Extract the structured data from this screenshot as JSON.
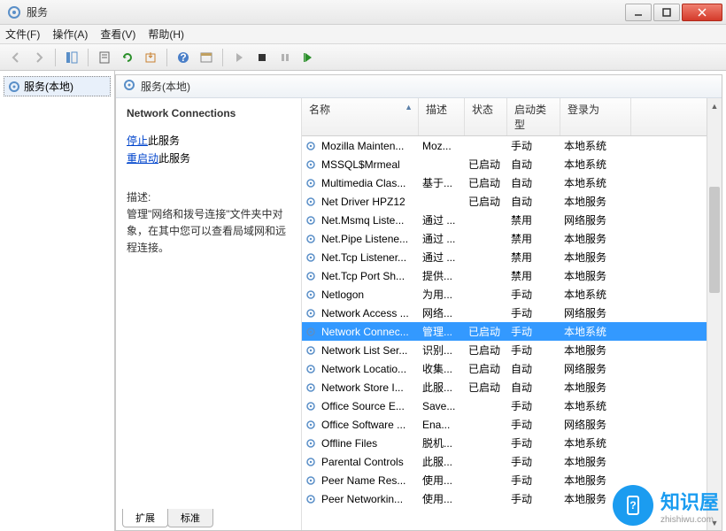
{
  "window": {
    "title": "服务"
  },
  "menu": {
    "file": "文件(F)",
    "action": "操作(A)",
    "view": "查看(V)",
    "help": "帮助(H)"
  },
  "tree": {
    "root": "服务(本地)"
  },
  "header": {
    "title": "服务(本地)"
  },
  "detail": {
    "selected_name": "Network Connections",
    "stop_link": "停止",
    "stop_suffix": "此服务",
    "restart_link": "重启动",
    "restart_suffix": "此服务",
    "desc_label": "描述:",
    "desc_text": "管理\"网络和拨号连接\"文件夹中对象，在其中您可以查看局域网和远程连接。"
  },
  "columns": {
    "name": "名称",
    "desc": "描述",
    "status": "状态",
    "startup": "启动类型",
    "logon": "登录为"
  },
  "tabs": {
    "extended": "扩展",
    "standard": "标准"
  },
  "watermark": {
    "brand": "知识屋",
    "url": "zhishiwu.com"
  },
  "rows": [
    {
      "name": "Mozilla Mainten...",
      "desc": "Moz...",
      "status": "",
      "startup": "手动",
      "logon": "本地系统",
      "selected": false
    },
    {
      "name": "MSSQL$Mrmeal",
      "desc": "",
      "status": "已启动",
      "startup": "自动",
      "logon": "本地系统",
      "selected": false
    },
    {
      "name": "Multimedia Clas...",
      "desc": "基于...",
      "status": "已启动",
      "startup": "自动",
      "logon": "本地系统",
      "selected": false
    },
    {
      "name": "Net Driver HPZ12",
      "desc": "",
      "status": "已启动",
      "startup": "自动",
      "logon": "本地服务",
      "selected": false
    },
    {
      "name": "Net.Msmq Liste...",
      "desc": "通过 ...",
      "status": "",
      "startup": "禁用",
      "logon": "网络服务",
      "selected": false
    },
    {
      "name": "Net.Pipe Listene...",
      "desc": "通过 ...",
      "status": "",
      "startup": "禁用",
      "logon": "本地服务",
      "selected": false
    },
    {
      "name": "Net.Tcp Listener...",
      "desc": "通过 ...",
      "status": "",
      "startup": "禁用",
      "logon": "本地服务",
      "selected": false
    },
    {
      "name": "Net.Tcp Port Sh...",
      "desc": "提供...",
      "status": "",
      "startup": "禁用",
      "logon": "本地服务",
      "selected": false
    },
    {
      "name": "Netlogon",
      "desc": "为用...",
      "status": "",
      "startup": "手动",
      "logon": "本地系统",
      "selected": false
    },
    {
      "name": "Network Access ...",
      "desc": "网络...",
      "status": "",
      "startup": "手动",
      "logon": "网络服务",
      "selected": false
    },
    {
      "name": "Network Connec...",
      "desc": "管理...",
      "status": "已启动",
      "startup": "手动",
      "logon": "本地系统",
      "selected": true
    },
    {
      "name": "Network List Ser...",
      "desc": "识别...",
      "status": "已启动",
      "startup": "手动",
      "logon": "本地服务",
      "selected": false
    },
    {
      "name": "Network Locatio...",
      "desc": "收集...",
      "status": "已启动",
      "startup": "自动",
      "logon": "网络服务",
      "selected": false
    },
    {
      "name": "Network Store I...",
      "desc": "此服...",
      "status": "已启动",
      "startup": "自动",
      "logon": "本地服务",
      "selected": false
    },
    {
      "name": "Office  Source E...",
      "desc": "Save...",
      "status": "",
      "startup": "手动",
      "logon": "本地系统",
      "selected": false
    },
    {
      "name": "Office Software ...",
      "desc": "Ena...",
      "status": "",
      "startup": "手动",
      "logon": "网络服务",
      "selected": false
    },
    {
      "name": "Offline Files",
      "desc": "脱机...",
      "status": "",
      "startup": "手动",
      "logon": "本地系统",
      "selected": false
    },
    {
      "name": "Parental Controls",
      "desc": "此服...",
      "status": "",
      "startup": "手动",
      "logon": "本地服务",
      "selected": false
    },
    {
      "name": "Peer Name Res...",
      "desc": "使用...",
      "status": "",
      "startup": "手动",
      "logon": "本地服务",
      "selected": false
    },
    {
      "name": "Peer Networkin...",
      "desc": "使用...",
      "status": "",
      "startup": "手动",
      "logon": "本地服务",
      "selected": false
    }
  ]
}
